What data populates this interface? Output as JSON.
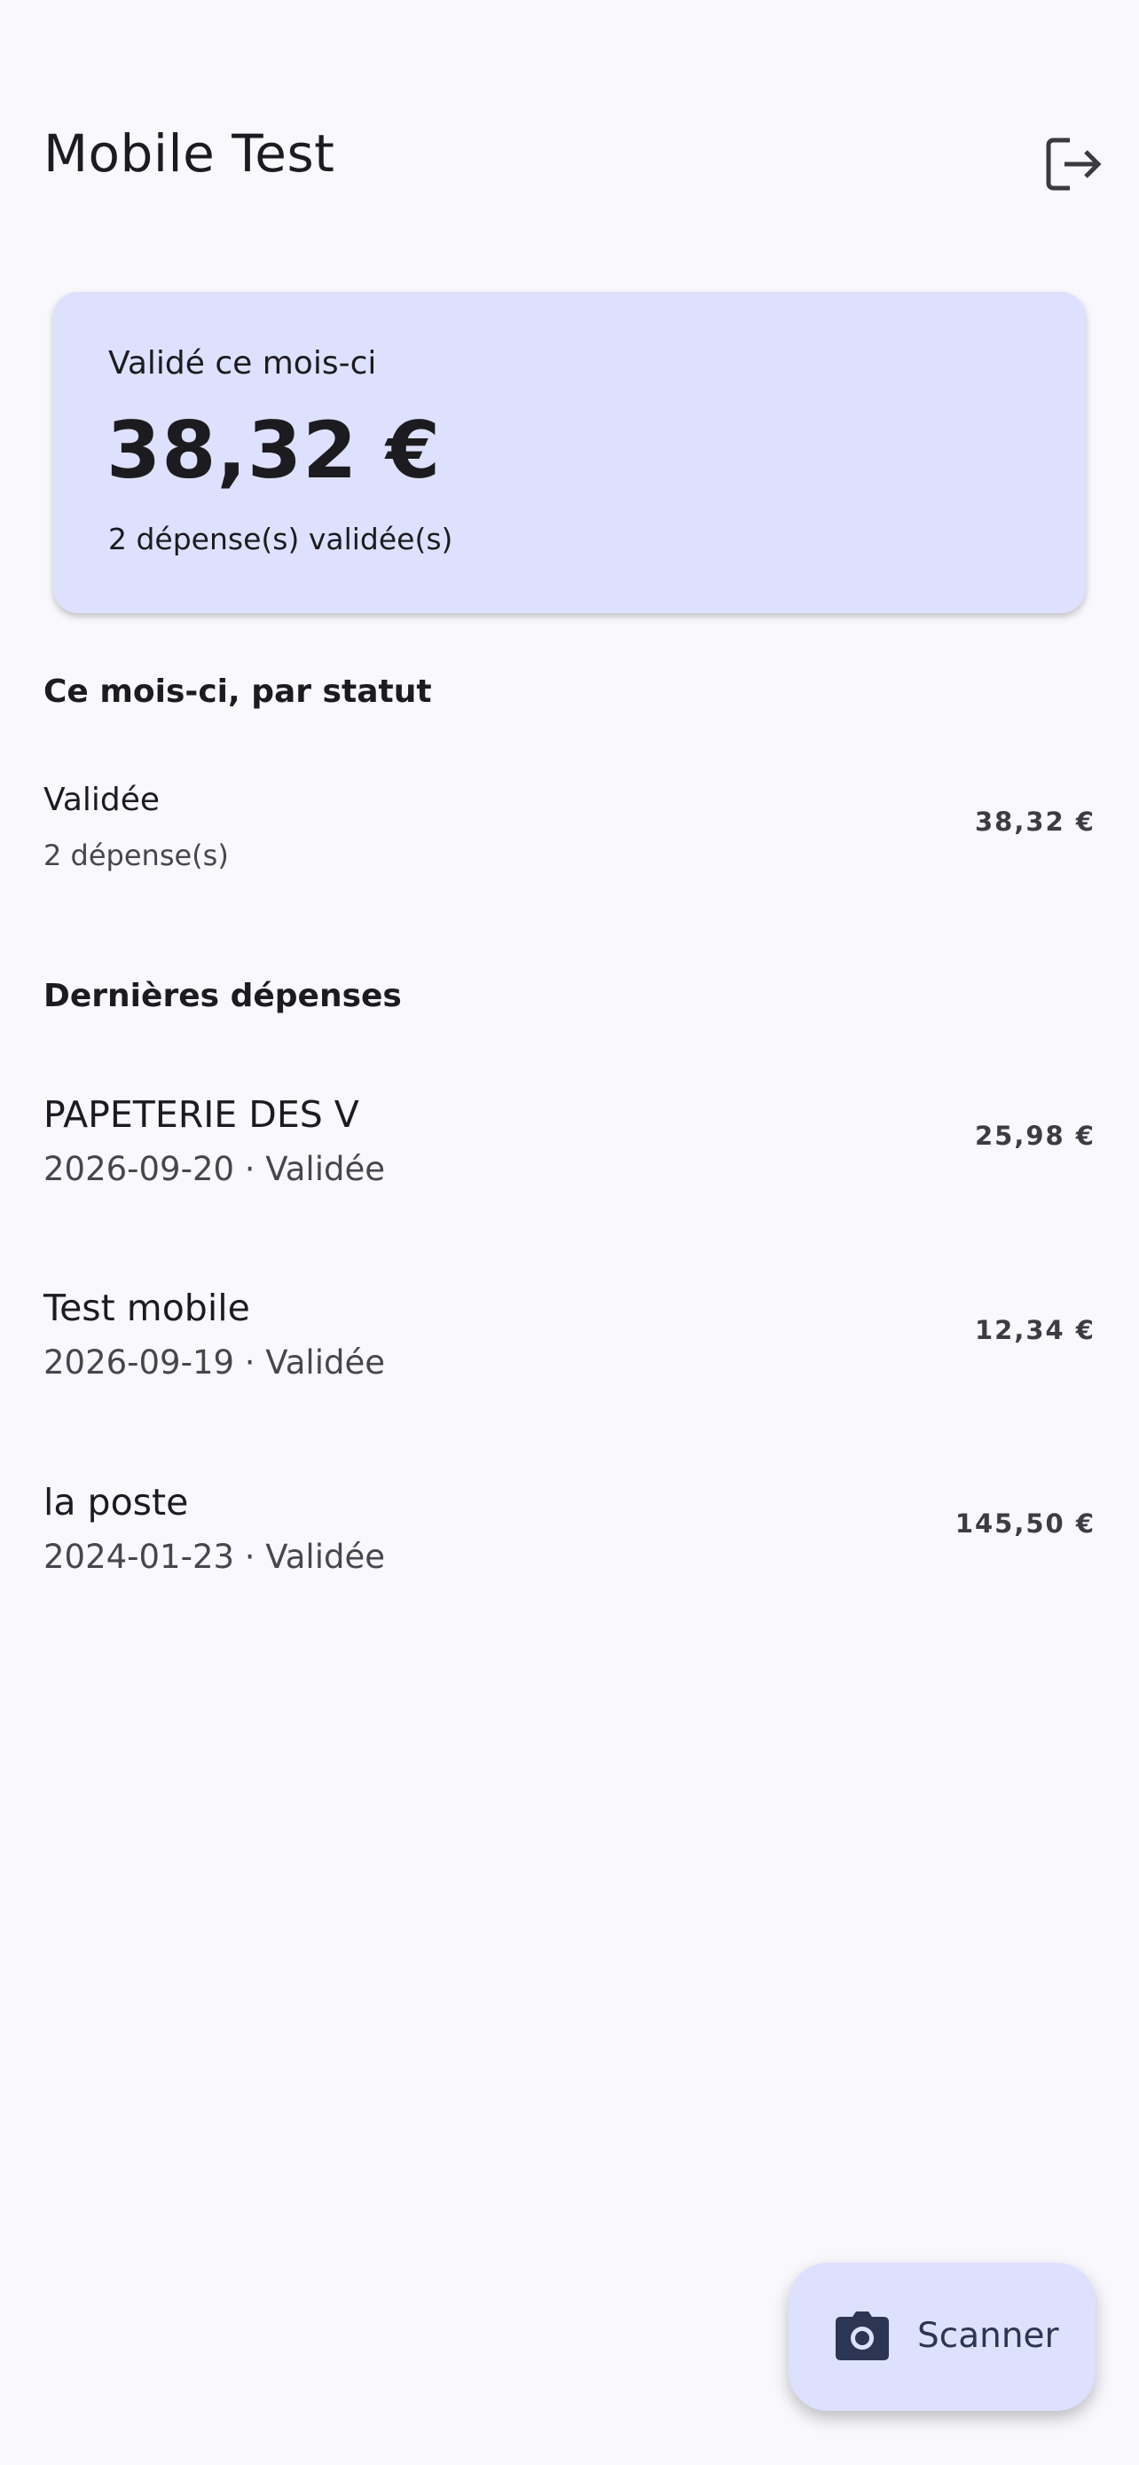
{
  "header": {
    "title": "Mobile Test",
    "logout_icon": "logout-icon"
  },
  "summary": {
    "label": "Validé ce mois-ci",
    "amount": "38,32 €",
    "subtitle": "2 dépense(s) validée(s)"
  },
  "status_section": {
    "title": "Ce mois-ci, par statut",
    "items": [
      {
        "status": "Validée",
        "count": "2 dépense(s)",
        "amount": "38,32 €"
      }
    ]
  },
  "recent_section": {
    "title": "Dernières dépenses",
    "items": [
      {
        "name": "PAPETERIE DES V",
        "meta": "2026-09-20 · Validée",
        "amount": "25,98 €"
      },
      {
        "name": "Test mobile",
        "meta": "2026-09-19 · Validée",
        "amount": "12,34 €"
      },
      {
        "name": "la poste",
        "meta": "2024-01-23 · Validée",
        "amount": "145,50 €"
      }
    ]
  },
  "fab": {
    "label": "Scanner",
    "icon": "camera-icon"
  },
  "colors": {
    "background": "#f8f8fd",
    "card": "#dde1fd",
    "accent": "#2c3553"
  }
}
